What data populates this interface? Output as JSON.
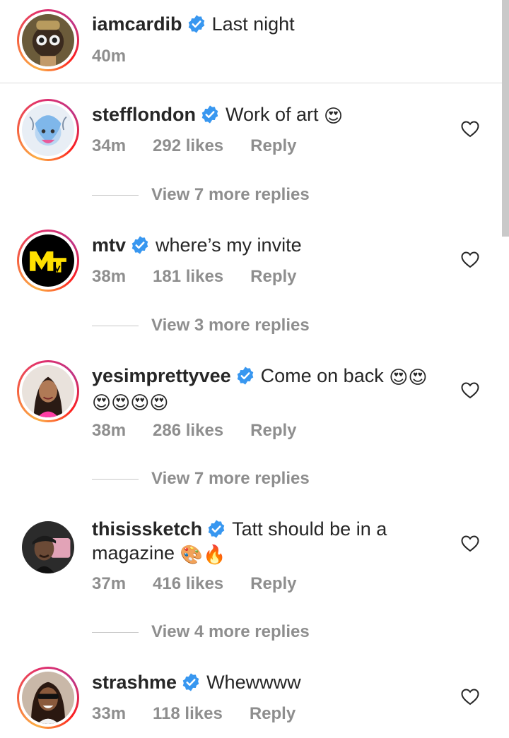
{
  "caption": {
    "username": "iamcardib",
    "text": "Last night",
    "time": "40m"
  },
  "comments": [
    {
      "username": "stefflondon",
      "text": "Work of art",
      "emoji": "😍",
      "time": "34m",
      "likes": "292 likes",
      "reply": "Reply",
      "view_replies": "View 7 more replies"
    },
    {
      "username": "mtv",
      "text": "where’s my invite",
      "emoji": "",
      "time": "38m",
      "likes": "181 likes",
      "reply": "Reply",
      "view_replies": "View 3 more replies"
    },
    {
      "username": "yesimprettyvee",
      "text": "Come on back",
      "emoji": "😍😍",
      "emoji_line2": "😍😍😍😍",
      "time": "38m",
      "likes": "286 likes",
      "reply": "Reply",
      "view_replies": "View 7 more replies"
    },
    {
      "username": "thisissketch",
      "text": "Tatt should be in a",
      "text_line2": "magazine",
      "emoji": "🎨🔥",
      "time": "37m",
      "likes": "416 likes",
      "reply": "Reply",
      "view_replies": "View 4 more replies"
    },
    {
      "username": "strashme",
      "text": "Whewwww",
      "emoji": "",
      "time": "33m",
      "likes": "118 likes",
      "reply": "Reply"
    }
  ],
  "colors": {
    "verified": "#3897f0",
    "meta": "#8e8e8e",
    "text": "#262626"
  }
}
